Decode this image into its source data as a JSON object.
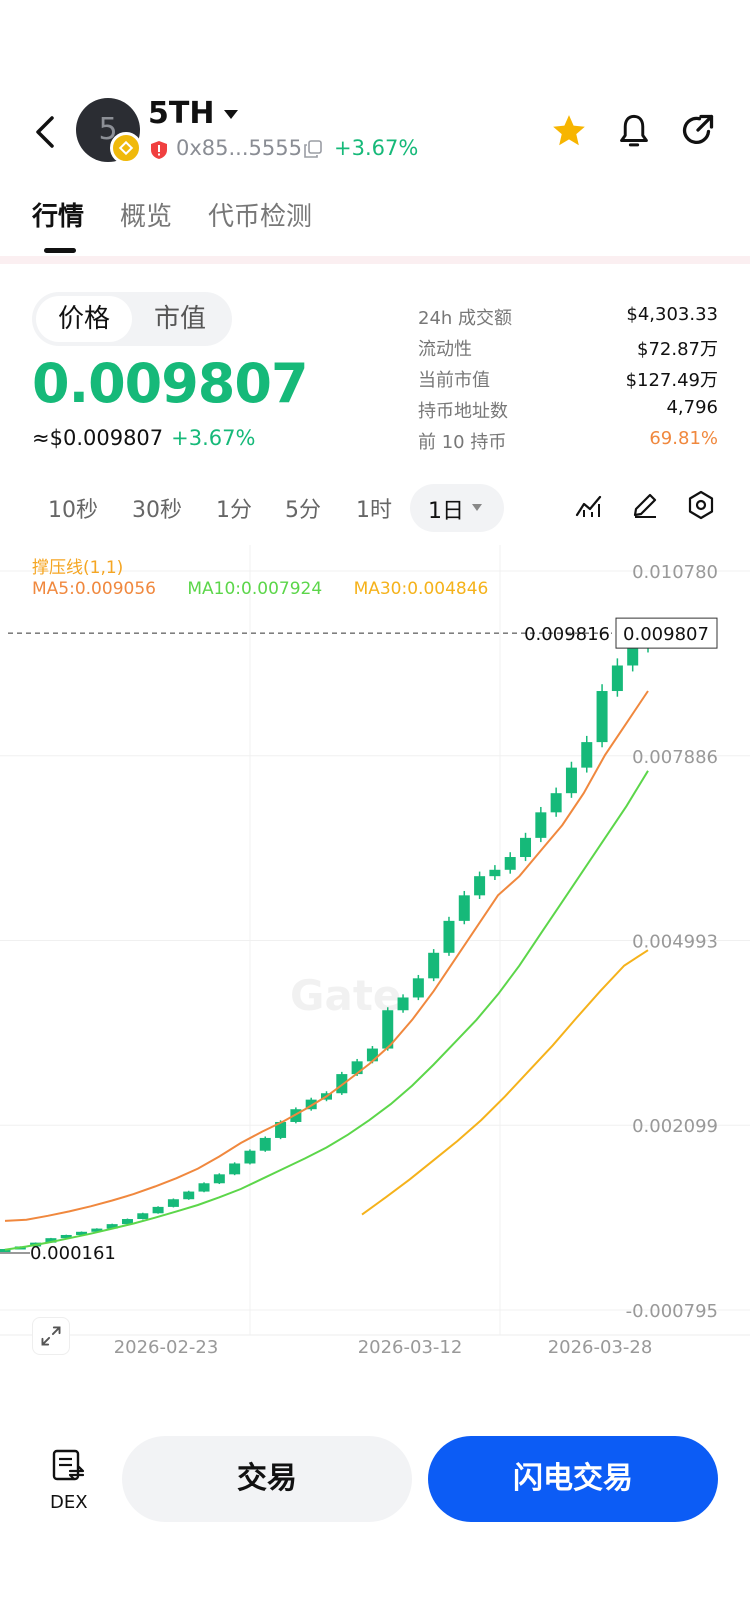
{
  "header": {
    "avatar_letter": "5",
    "token_name": "5TH",
    "address": "0x85...5555",
    "change": "+3.67%"
  },
  "tabs": [
    "行情",
    "概览",
    "代币检测"
  ],
  "segment": [
    "价格",
    "市值"
  ],
  "price": {
    "value": "0.009807",
    "usd": "≈$0.009807",
    "change": "+3.67%"
  },
  "stats": [
    {
      "label": "24h 成交额",
      "value": "$4,303.33"
    },
    {
      "label": "流动性",
      "value": "$72.87万"
    },
    {
      "label": "当前市值",
      "value": "$127.49万"
    },
    {
      "label": "持币地址数",
      "value": "4,796"
    },
    {
      "label": "前 10 持币",
      "value": "69.81%"
    }
  ],
  "colors": {
    "up": "#16b979",
    "top10": "#f0883e",
    "ma5": "#f0883e",
    "ma10": "#5cd64a",
    "ma30": "#f5b21b",
    "primary": "#0c5cf5"
  },
  "intervals": [
    "10秒",
    "30秒",
    "1分",
    "5分",
    "1时"
  ],
  "active_interval": "1日",
  "icons": [
    "back-icon",
    "copy-icon",
    "star-icon",
    "bell-icon",
    "share-icon",
    "indicator-icon",
    "draw-icon",
    "settings-icon",
    "expand-icon",
    "dex-icon"
  ],
  "chart": {
    "legend_line": "撑压线(1,1)",
    "ma5": "MA5:0.009056",
    "ma10": "MA10:0.007924",
    "ma30": "MA30:0.004846",
    "current_label": "0.009816",
    "current_box": "0.009807",
    "low_label": "0.000161",
    "watermark": "Gate"
  },
  "chart_data": {
    "type": "candlestick",
    "y_ticks": [
      "0.010780",
      "0.007886",
      "0.004993",
      "0.002099",
      "-0.000795"
    ],
    "ylim": [
      -0.000795,
      0.01078
    ],
    "x_ticks": [
      "2026-02-23",
      "2026-03-12",
      "2026-03-28"
    ],
    "current_price": 0.009807,
    "close": [
      0.00016,
      0.0002,
      0.00026,
      0.00033,
      0.00038,
      0.00043,
      0.00048,
      0.00055,
      0.00063,
      0.00072,
      0.00082,
      0.00094,
      0.00106,
      0.00119,
      0.00133,
      0.0015,
      0.0017,
      0.0019,
      0.00215,
      0.00235,
      0.0025,
      0.0026,
      0.0029,
      0.0031,
      0.0033,
      0.0039,
      0.0041,
      0.0044,
      0.0048,
      0.0053,
      0.0057,
      0.006,
      0.0061,
      0.0063,
      0.0066,
      0.007,
      0.0073,
      0.0077,
      0.0081,
      0.0089,
      0.0093,
      0.0096,
      0.0098
    ],
    "ma5": [
      0.0006,
      0.00062,
      0.00068,
      0.00075,
      0.00083,
      0.00092,
      0.00102,
      0.00114,
      0.00127,
      0.00142,
      0.00161,
      0.00182,
      0.002,
      0.00216,
      0.00235,
      0.00255,
      0.0028,
      0.00306,
      0.00336,
      0.00375,
      0.0042,
      0.0047,
      0.0052,
      0.0057,
      0.006,
      0.0064,
      0.0068,
      0.0073,
      0.0079,
      0.0084,
      0.0089
    ],
    "ma10": [
      0.00015,
      0.0002,
      0.00026,
      0.00033,
      0.0004,
      0.00048,
      0.00056,
      0.00065,
      0.00075,
      0.00085,
      0.00097,
      0.0011,
      0.00126,
      0.00142,
      0.00158,
      0.00175,
      0.00195,
      0.00218,
      0.00243,
      0.00272,
      0.00305,
      0.0034,
      0.00375,
      0.00415,
      0.0046,
      0.0051,
      0.0056,
      0.0061,
      0.0066,
      0.0071,
      0.00765
    ],
    "ma30": [
      0.0007,
      0.00097,
      0.00125,
      0.00155,
      0.00185,
      0.00218,
      0.00255,
      0.00295,
      0.00335,
      0.00378,
      0.0042,
      0.0046,
      0.00484
    ]
  },
  "bottom": {
    "dex": "DEX",
    "trade": "交易",
    "flash": "闪电交易"
  }
}
